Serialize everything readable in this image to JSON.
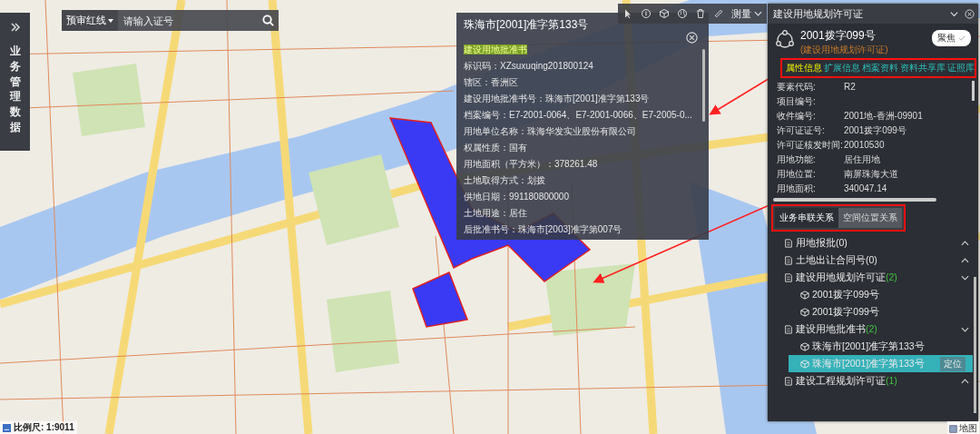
{
  "search": {
    "mode": "预审红线",
    "placeholder": "请输入证号"
  },
  "sidebar": {
    "label": "业务管理数据"
  },
  "toolbar": {
    "measure": "测量"
  },
  "popup": {
    "title": "珠海市[2001]准字第133号",
    "subtitle": "建设用地批准书",
    "fields": [
      {
        "label": "标识码：",
        "value": "XZsuxuqing201800124"
      },
      {
        "label": "辖区：",
        "value": "香洲区"
      },
      {
        "label": "建设用地批准书号：",
        "value": "珠海市[2001]准字第133号"
      },
      {
        "label": "档案编号：",
        "value": "E7-2001-0064、E7-2001-0066、E7-2005-0..."
      },
      {
        "label": "用地单位名称：",
        "value": "珠海华发实业股份有限公司"
      },
      {
        "label": "权属性质：",
        "value": "国有"
      },
      {
        "label": "用地面积（平方米）：",
        "value": "378261.48"
      },
      {
        "label": "土地取得方式：",
        "value": "划拨"
      },
      {
        "label": "供地日期：",
        "value": "991180800000"
      },
      {
        "label": "土地用途：",
        "value": "居住"
      },
      {
        "label": "后批准书号：",
        "value": "珠海市[2003]准字第007号"
      }
    ]
  },
  "panel": {
    "title": "建设用地规划许可证",
    "record": {
      "title": "2001拨字099号",
      "subtitle": "(建设用地规划许可证)",
      "focus_button": "聚焦"
    },
    "tabs": [
      {
        "label": "属性信息",
        "selected": true
      },
      {
        "label": "扩展信息",
        "selected": false
      },
      {
        "label": "档案资料",
        "selected": false
      },
      {
        "label": "资料共享库",
        "selected": false
      },
      {
        "label": "证照库",
        "selected": false
      }
    ],
    "attributes": [
      {
        "label": "要素代码:",
        "value": "R2"
      },
      {
        "label": "项目编号:"
      },
      {
        "label": "收件编号:",
        "value": "2001地-香洲-09901"
      },
      {
        "label": "许可证证号:",
        "value": "2001拨字099号"
      },
      {
        "label": "许可证核发时间:",
        "value": "20010530"
      },
      {
        "label": "用地功能:",
        "value": "居住用地"
      },
      {
        "label": "用地位置:",
        "value": "南屏珠海大道"
      },
      {
        "label": "用地面积:",
        "value": "340047.14"
      }
    ],
    "relation_tabs": [
      {
        "label": "业务串联关系",
        "selected": true
      },
      {
        "label": "空间位置关系",
        "selected": false
      }
    ],
    "tree": [
      {
        "title": "用地报批",
        "count": "(0)",
        "expanded": false
      },
      {
        "title": "土地出让合同号",
        "count": "(0)",
        "expanded": false
      },
      {
        "title": "建设用地规划许可证",
        "count": "(2)",
        "expanded": true,
        "children": [
          {
            "title": "2001拨字099号",
            "selected": false
          },
          {
            "title": "2001拨字099号",
            "selected": false
          }
        ]
      },
      {
        "title": "建设用地批准书",
        "count": "(2)",
        "expanded": true,
        "children": [
          {
            "title": "珠海市[2001]准字第133号",
            "selected": false
          },
          {
            "title": "珠海市[2001]准字第133号",
            "selected": true,
            "action": "定位"
          }
        ]
      },
      {
        "title": "建设工程规划许可证",
        "count": "(1)",
        "expanded": false
      }
    ]
  },
  "scale": {
    "label": "比例尺: 1:9011"
  },
  "map_switch": {
    "label": "地图"
  }
}
